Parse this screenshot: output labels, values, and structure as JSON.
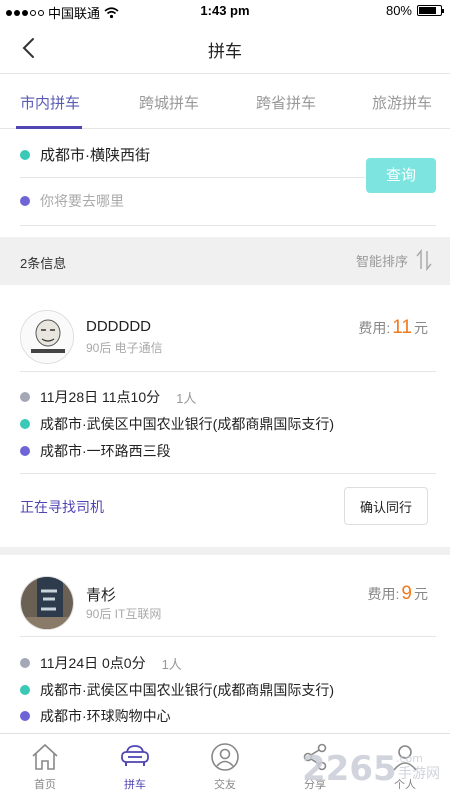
{
  "status_bar": {
    "carrier": "中国联通",
    "time": "1:43 pm",
    "battery": "80%",
    "battery_level": 0.8
  },
  "nav": {
    "title": "拼车"
  },
  "tabs": [
    {
      "label": "市内拼车",
      "active": true
    },
    {
      "label": "跨城拼车",
      "active": false
    },
    {
      "label": "跨省拼车",
      "active": false
    },
    {
      "label": "旅游拼车",
      "active": false
    }
  ],
  "search": {
    "from": "成都市·横陕西街",
    "to_placeholder": "你将要去哪里",
    "query_label": "查询"
  },
  "info": {
    "count": "2条信息",
    "sort_label": "智能排序"
  },
  "fee_label": "费用:",
  "fee_unit": "元",
  "cards": [
    {
      "name": "DDDDDD",
      "sub": "90后 电子通信",
      "fee": "11",
      "date": "11月28日 11点10分",
      "people": "1人",
      "from": "成都市·武侯区中国农业银行(成都商鼎国际支行)",
      "to": "成都市·一环路西三段",
      "status": "正在寻找司机",
      "action": "确认同行"
    },
    {
      "name": "青杉",
      "sub": "90后 IT互联网",
      "fee": "9",
      "date": "11月24日 0点0分",
      "people": "1人",
      "from": "成都市·武侯区中国农业银行(成都商鼎国际支行)",
      "to": "成都市·环球购物中心"
    }
  ],
  "tabbar": [
    {
      "label": "首页",
      "icon": "home-icon",
      "active": false
    },
    {
      "label": "拼车",
      "icon": "car-icon",
      "active": true
    },
    {
      "label": "交友",
      "icon": "friends-icon",
      "active": false
    },
    {
      "label": "分享",
      "icon": "share-icon",
      "active": false
    },
    {
      "label": "个人",
      "icon": "person-icon",
      "active": false
    }
  ],
  "watermark": {
    "text": "2265",
    "suffix": ".com",
    "sub": "手游网"
  },
  "colors": {
    "accent": "#4f46b4",
    "from_dot": "#39c9b6",
    "to_dot": "#6e64d6",
    "time_dot": "#a4a8b6",
    "query_button": "#7ee4e0",
    "fee": "#ef7b1e"
  }
}
